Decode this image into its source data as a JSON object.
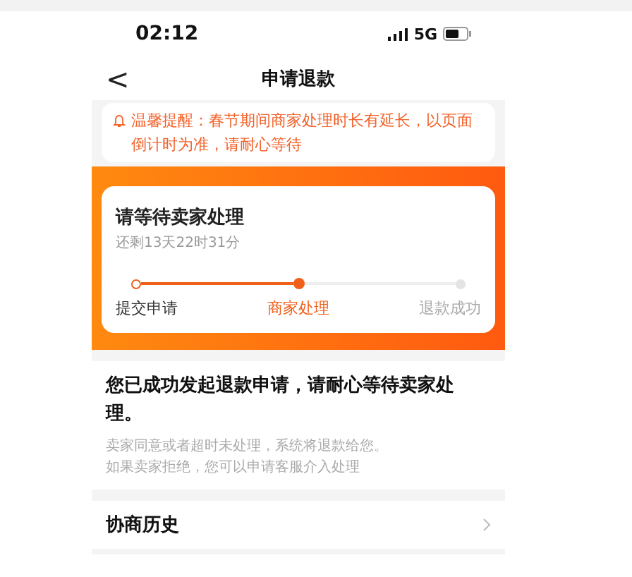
{
  "status_bar": {
    "time": "02:12",
    "network": "5G"
  },
  "nav": {
    "back": "<",
    "title": "申请退款"
  },
  "notice": "温馨提醒：春节期间商家处理时长有延长，以页面倒计时为准，请耐心等待",
  "progress": {
    "title": "请等待卖家处理",
    "countdown": "还剩13天22时31分",
    "steps": [
      {
        "label": "提交申请",
        "kind": "done"
      },
      {
        "label": "商家处理",
        "kind": "current"
      },
      {
        "label": "退款成功",
        "kind": "pending"
      }
    ]
  },
  "message": {
    "headline": "您已成功发起退款申请，请耐心等待卖家处理。",
    "lines": [
      "卖家同意或者超时未处理，系统将退款给您。",
      "如果卖家拒绝，您可以申请客服介入处理"
    ]
  },
  "history": {
    "label": "协商历史"
  }
}
